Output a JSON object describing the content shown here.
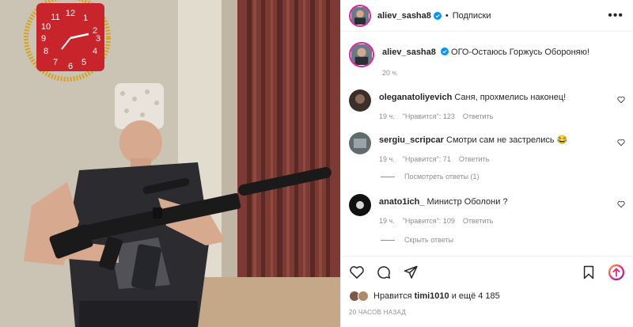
{
  "header": {
    "username": "aliev_sasha8",
    "separator": "•",
    "follow_label": "Подписки",
    "more_label": "•••"
  },
  "caption": {
    "username": "aliev_sasha8",
    "text": "ОГО-Остаюсь Горжусь Обороняю!",
    "time": "20 ч."
  },
  "comments": [
    {
      "username": "oleganatoliyevich",
      "text": "Саня, прохмелись наконец!",
      "time": "19 ч.",
      "likes": "\"Нравится\": 123",
      "reply": "Ответить",
      "avatar_color": "#3b2f2a"
    },
    {
      "username": "sergiu_scripcar",
      "text": "Смотри сам не застрелись 😂",
      "time": "19 ч.",
      "likes": "\"Нравится\": 71",
      "reply": "Ответить",
      "avatar_color": "#5f6b6e",
      "toggle": "Посмотреть ответы (1)"
    },
    {
      "username": "anato1ich_",
      "text": "Министр Оболони ?",
      "time": "19 ч.",
      "likes": "\"Нравится\": 109",
      "reply": "Ответить",
      "avatar_color": "#111111",
      "toggle": "Скрыть ответы"
    }
  ],
  "footer": {
    "likes_prefix": "Нравится",
    "likes_user": "timi1010",
    "likes_suffix": "и ещё 4 185",
    "posted_ago": "20 ЧАСОВ НАЗАД"
  },
  "photo": {
    "clock_digits": [
      "12",
      "1",
      "2",
      "3",
      "4",
      "5",
      "6",
      "7",
      "8",
      "9",
      "10",
      "11"
    ]
  },
  "colors": {
    "text": "#262626",
    "muted": "#8e8e8e",
    "verified": "#0095f6",
    "clock_red": "#c8242b",
    "tinsel": "#d6a21e"
  },
  "icons": [
    "heart-icon",
    "comment-icon",
    "share-icon",
    "bookmark-icon",
    "boost-icon",
    "verified-icon",
    "more-icon"
  ]
}
